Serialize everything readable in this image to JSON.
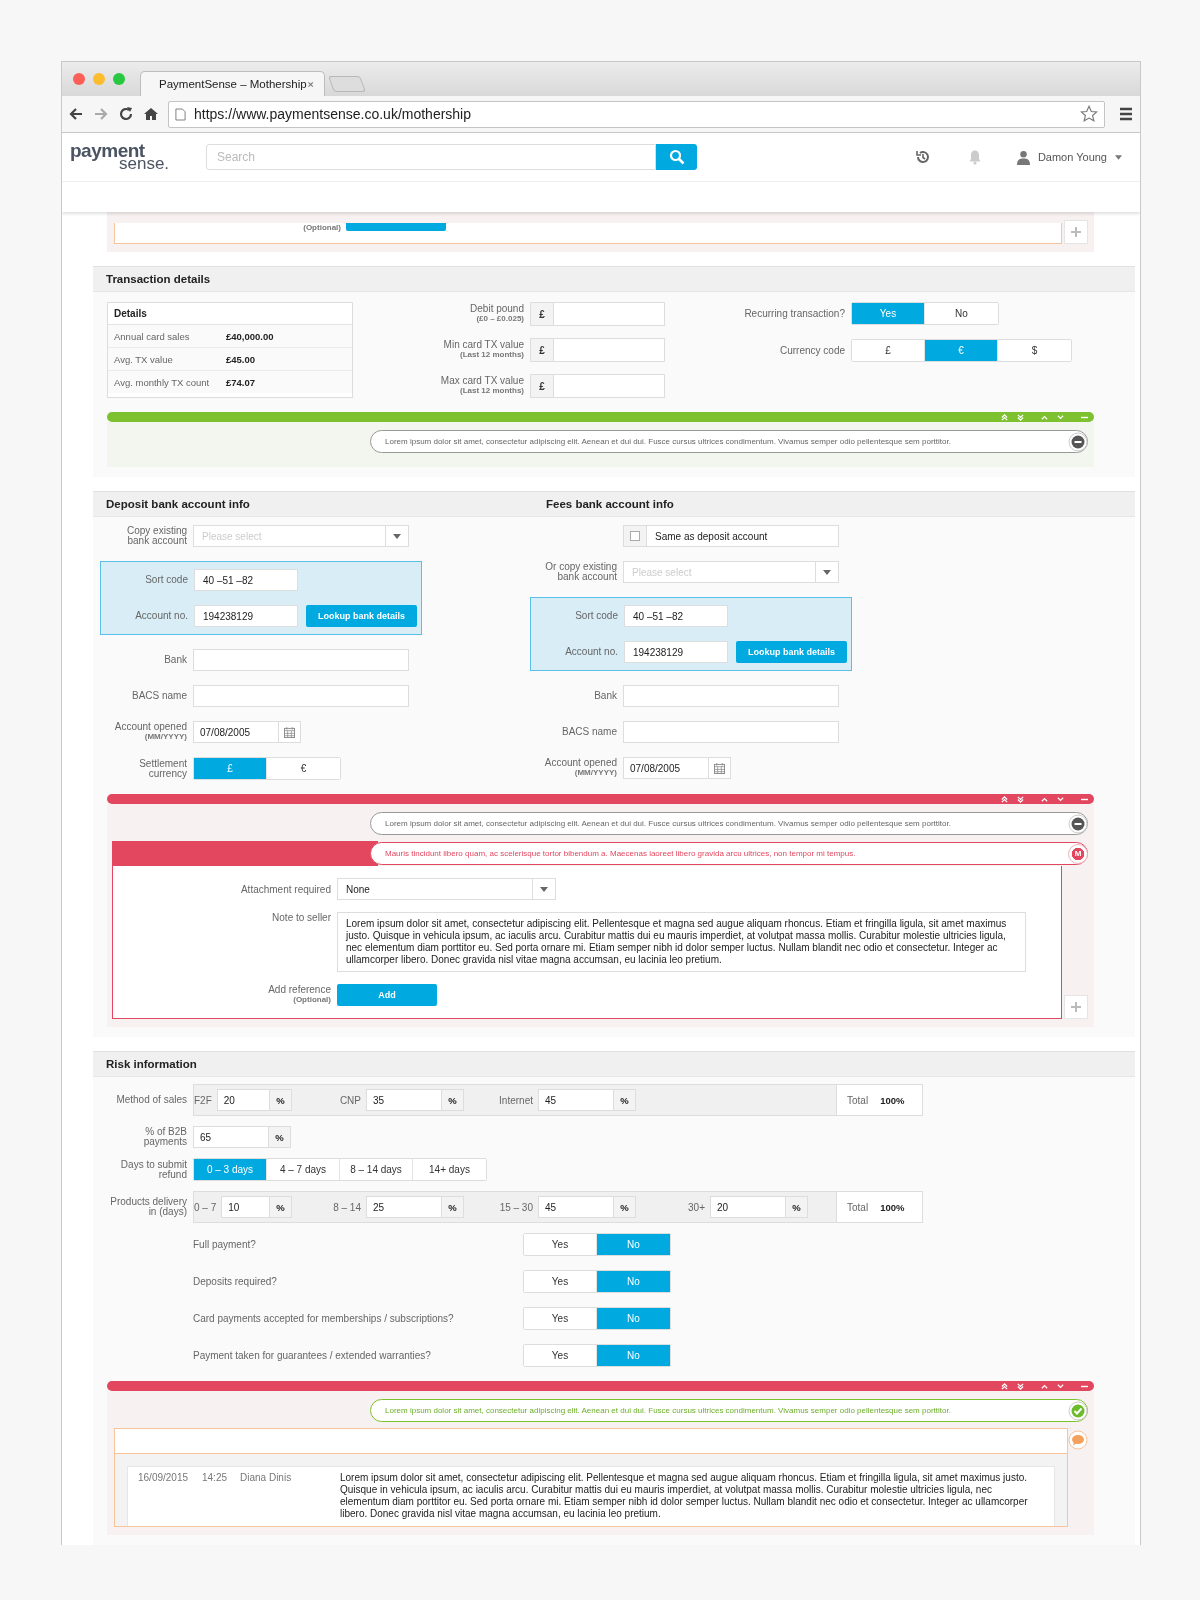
{
  "browser": {
    "tab_title": "PaymentSense – Mothership",
    "url": "https://www.paymentsense.co.uk/mothership"
  },
  "header": {
    "logo_top": "payment",
    "logo_bottom": "sense.",
    "search_placeholder": "Search",
    "user_name": "Damon Young"
  },
  "top_fragment": {
    "hint": "(Optional)"
  },
  "transaction": {
    "title": "Transaction details",
    "details": {
      "title": "Details",
      "rows": [
        {
          "label": "Annual card sales",
          "value": "£40,000.00"
        },
        {
          "label": "Avg. TX value",
          "value": "£45.00"
        },
        {
          "label": "Avg. monthly TX count",
          "value": "£74.07"
        }
      ]
    },
    "amounts": [
      {
        "label": "Debit pound",
        "hint": "(£0 – £0.025)",
        "prefix": "£"
      },
      {
        "label": "Min card TX value",
        "hint": "(Last 12 months)",
        "prefix": "£"
      },
      {
        "label": "Max card TX value",
        "hint": "(Last 12 months)",
        "prefix": "£"
      }
    ],
    "choices": [
      {
        "label": "Recurring transaction?",
        "options": [
          {
            "label": "Yes",
            "selected": true
          },
          {
            "label": "No",
            "selected": false
          }
        ]
      },
      {
        "label": "Currency code",
        "options": [
          {
            "label": "£",
            "selected": false
          },
          {
            "label": "€",
            "selected": true
          },
          {
            "label": "$",
            "selected": false
          }
        ]
      }
    ],
    "panel": {
      "color": "#7dc12f",
      "messages": [
        {
          "kind": "note",
          "text": "Lorem ipsum dolor sit amet, consectetur adipiscing elit. Aenean et dui dui. Fusce cursus ultrices condimentum. Vivamus semper odio pellentesque sem porttitor."
        }
      ]
    }
  },
  "bank": {
    "deposit": {
      "title": "Deposit bank account info",
      "copy": {
        "label": "Copy existing bank account",
        "placeholder": "Please select"
      },
      "sort_code": {
        "label": "Sort code",
        "value": "40 –51 –82"
      },
      "account_no": {
        "label": "Account no.",
        "value": "194238129"
      },
      "lookup": "Lookup bank details",
      "bank_label": "Bank",
      "bacs_label": "BACS name",
      "opened": {
        "label": "Account opened",
        "hint": "(MM/YYYY)",
        "value": "07/08/2005"
      },
      "settlement": {
        "label": "Settlement currency",
        "options": [
          {
            "label": "£",
            "selected": true
          },
          {
            "label": "€",
            "selected": false
          }
        ]
      }
    },
    "fees": {
      "title": "Fees bank account info",
      "same": {
        "label": "Same as deposit account",
        "checked": false
      },
      "copy": {
        "label": "Or copy existing bank account",
        "placeholder": "Please select"
      },
      "sort_code": {
        "label": "Sort code",
        "value": "40 –51 –82"
      },
      "account_no": {
        "label": "Account no.",
        "value": "194238129"
      },
      "lookup": "Lookup bank details",
      "bank_label": "Bank",
      "bacs_label": "BACS name",
      "opened": {
        "label": "Account opened",
        "hint": "(MM/YYYY)",
        "value": "07/08/2005"
      }
    },
    "panel": {
      "color": "#e2475f",
      "messages": [
        {
          "kind": "note",
          "text": "Lorem ipsum dolor sit amet, consectetur adipiscing elit. Aenean et dui dui. Fusce cursus ultrices condimentum. Vivamus semper odio pellentesque sem porttitor."
        },
        {
          "kind": "error",
          "badge": "M",
          "text": "Mauris tincidunt libero quam, ac scelerisque tortor bibendum a. Maecenas laoreet libero gravida arcu ultrices, non tempor mi tempus."
        }
      ],
      "form": {
        "attachment": {
          "label": "Attachment required",
          "value": "None"
        },
        "note": {
          "label": "Note to seller",
          "value": "Lorem ipsum dolor sit amet, consectetur adipiscing elit. Pellentesque et magna sed augue aliquam rhoncus. Etiam et fringilla ligula, sit amet maximus justo. Quisque in vehicula ipsum, ac iaculis arcu. Curabitur mattis dui eu mauris imperdiet, at volutpat massa mollis. Curabitur molestie ultricies ligula, nec elementum diam porttitor eu. Sed porta ornare mi. Etiam semper nibh id dolor semper luctus. Nullam blandit nec odio et consectetur. Integer ac ullamcorper libero. Donec gravida nisl vitae magna accumsan, eu lacinia leo pretium."
        },
        "reference": {
          "label": "Add reference",
          "hint": "(Optional)",
          "button": "Add"
        }
      }
    }
  },
  "risk": {
    "title": "Risk information",
    "method": {
      "label": "Method of sales",
      "items": [
        {
          "label": "F2F",
          "value": "20",
          "unit": "%"
        },
        {
          "label": "CNP",
          "value": "35",
          "unit": "%"
        },
        {
          "label": "Internet",
          "value": "45",
          "unit": "%"
        }
      ],
      "total_label": "Total",
      "total": "100%"
    },
    "b2b": {
      "label": "% of B2B payments",
      "value": "65",
      "unit": "%"
    },
    "refund": {
      "label": "Days to submit refund",
      "options": [
        {
          "label": "0 – 3 days",
          "selected": true
        },
        {
          "label": "4 – 7 days",
          "selected": false
        },
        {
          "label": "8 – 14 days",
          "selected": false
        },
        {
          "label": "14+ days",
          "selected": false
        }
      ]
    },
    "delivery": {
      "label": "Products delivery in (days)",
      "items": [
        {
          "label": "0 – 7",
          "value": "10",
          "unit": "%"
        },
        {
          "label": "8 – 14",
          "value": "25",
          "unit": "%"
        },
        {
          "label": "15 – 30",
          "value": "45",
          "unit": "%"
        },
        {
          "label": "30+",
          "value": "20",
          "unit": "%"
        }
      ],
      "total_label": "Total",
      "total": "100%"
    },
    "questions": [
      {
        "label": "Full payment?",
        "options": [
          {
            "label": "Yes",
            "selected": false
          },
          {
            "label": "No",
            "selected": true
          }
        ]
      },
      {
        "label": "Deposits required?",
        "options": [
          {
            "label": "Yes",
            "selected": false
          },
          {
            "label": "No",
            "selected": true
          }
        ]
      },
      {
        "label": "Card payments accepted for memberships / subscriptions?",
        "options": [
          {
            "label": "Yes",
            "selected": false
          },
          {
            "label": "No",
            "selected": true
          }
        ]
      },
      {
        "label": "Payment taken for guarantees / extended warranties?",
        "options": [
          {
            "label": "Yes",
            "selected": false
          },
          {
            "label": "No",
            "selected": true
          }
        ]
      }
    ],
    "panel": {
      "color": "#e2475f",
      "messages": [
        {
          "kind": "success",
          "text": "Lorem ipsum dolor sit amet, consectetur adipiscing elit. Aenean et dui dui. Fusce cursus ultrices condimentum. Vivamus semper odio pellentesque sem porttitor."
        }
      ],
      "comments": [
        {
          "date": "16/09/2015",
          "time": "14:25",
          "author": "Diana Dinis",
          "text": "Lorem ipsum dolor sit amet, consectetur adipiscing elit. Pellentesque et magna sed augue aliquam rhoncus. Etiam et fringilla ligula, sit amet maximus justo. Quisque in vehicula ipsum, ac iaculis arcu. Curabitur mattis dui eu mauris imperdiet, at volutpat massa mollis. Curabitur molestie ultricies ligula, nec elementum diam porttitor eu. Sed porta ornare mi. Etiam semper nibh id dolor semper luctus. Nullam blandit nec odio et consectetur. Integer ac ullamcorper libero. Donec gravida nisl vitae magna accumsan, eu lacinia leo pretium."
        }
      ]
    }
  }
}
